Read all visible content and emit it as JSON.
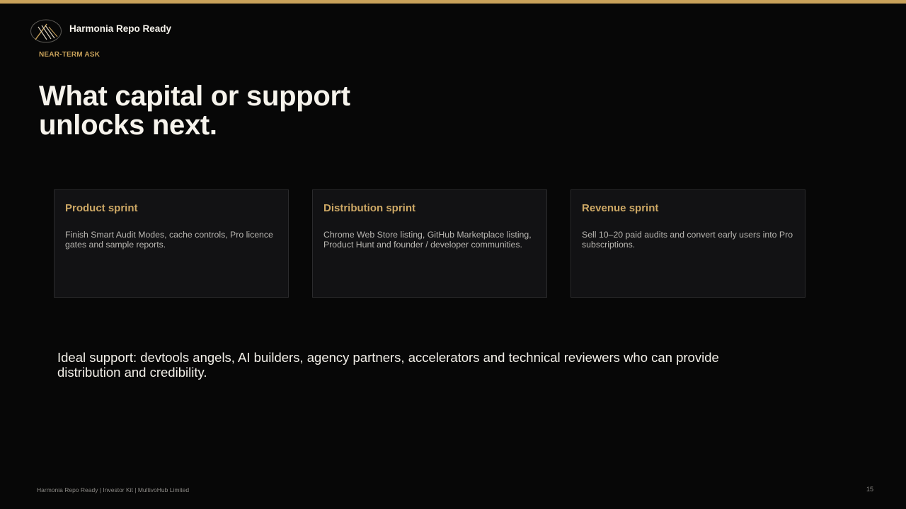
{
  "brand": {
    "name": "Harmonia Repo Ready",
    "logo_icon": "harp-emblem-icon",
    "accent_color": "#c9a25a"
  },
  "eyebrow": "NEAR-TERM ASK",
  "title": "What capital or support unlocks next.",
  "cards": [
    {
      "title": "Product sprint",
      "body": "Finish Smart Audit Modes, cache controls, Pro licence gates and sample reports."
    },
    {
      "title": "Distribution sprint",
      "body": "Chrome Web Store listing, GitHub Marketplace listing, Product Hunt and founder / developer communities."
    },
    {
      "title": "Revenue sprint",
      "body": "Sell 10–20 paid audits and convert early users into Pro subscriptions."
    }
  ],
  "support_text": "Ideal support: devtools angels, AI builders, agency partners, accelerators and technical reviewers who can provide distribution and credibility.",
  "footer": {
    "left": "Harmonia Repo Ready | Investor Kit | MultivoHub Limited",
    "page_number": "15"
  }
}
